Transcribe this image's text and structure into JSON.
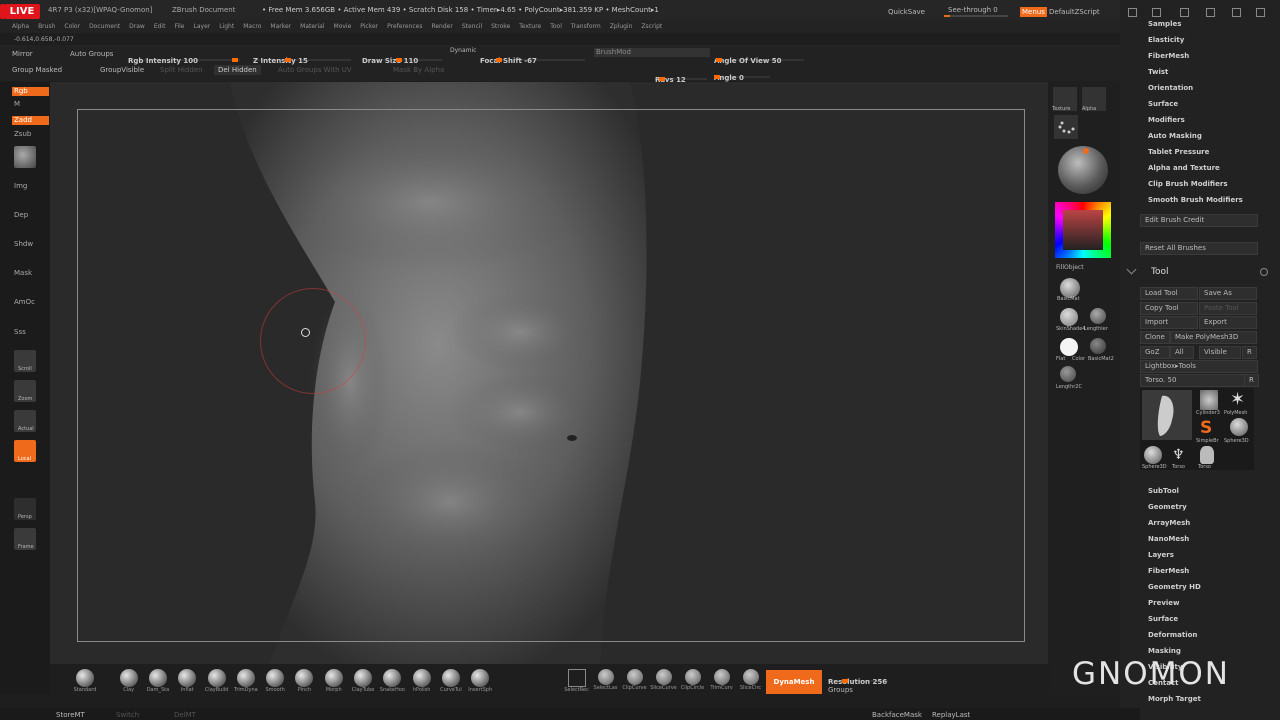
{
  "title_bar": {
    "live": "LIVE",
    "app_info": "4R7 P3 (x32)[WPAQ-Gnomon]",
    "document": "ZBrush Document",
    "mem_info": "• Free Mem 3.656GB • Active Mem 439 • Scratch Disk 158 • Timer▸4.65 • PolyCount▸381.359 KP • MeshCount▸1",
    "quicksave": "QuickSave",
    "see_through": "See-through 0",
    "menus_label": "Menus",
    "default_zscript": "DefaultZScript"
  },
  "menu": [
    "Alpha",
    "Brush",
    "Color",
    "Document",
    "Draw",
    "Edit",
    "File",
    "Layer",
    "Light",
    "Macro",
    "Marker",
    "Material",
    "Movie",
    "Picker",
    "Preferences",
    "Render",
    "Stencil",
    "Stroke",
    "Texture",
    "Tool",
    "Transform",
    "Zplugin",
    "Zscript"
  ],
  "coords": "-0.614,0.658,-0.077",
  "tool_row": {
    "mirror": "Mirror",
    "auto_groups": "Auto Groups",
    "rgb_intensity": "Rgb Intensity 100",
    "z_intensity": "Z Intensity 15",
    "draw_size": "Draw Size 110",
    "dynamic": "Dynamic",
    "focal_shift": "Focal Shift -67",
    "brush_mod": "BrushMod",
    "angle_of_view": "Angle Of View 50",
    "group_masked": "Group Masked",
    "group_visible": "GroupVisible",
    "split_hidden": "Split Hidden",
    "del_hidden": "Del Hidden",
    "auto_groups_uv": "Auto Groups With UV",
    "mask_by_alpha": "Mask By Alpha",
    "rays": "Rays 12",
    "angle": "Angle 0"
  },
  "left_shelf": [
    "Rgb",
    "M",
    "Zadd",
    "Zsub",
    "Img",
    "Dep",
    "Shdw",
    "Mask",
    "AmOc",
    "Sss",
    "Scroll",
    "Zoom",
    "Actual",
    "Local",
    "Persp",
    "Frame"
  ],
  "right_tray": {
    "texture": "Texture",
    "alpha": "Alpha",
    "fill_object": "FillObject",
    "material_labels": [
      "BasicMat",
      "SkinShade4",
      "Lengthier",
      "Flat",
      "Color",
      "BasicMat2",
      "Lengthr2C"
    ]
  },
  "right_panel": {
    "brush_items": [
      "Samples",
      "Elasticity",
      "FiberMesh",
      "Twist",
      "Orientation",
      "Surface",
      "Modifiers",
      "Auto Masking",
      "Tablet Pressure",
      "Alpha and Texture",
      "Clip Brush Modifiers",
      "Smooth Brush Modifiers"
    ],
    "edit_brush_credit": "Edit Brush Credit",
    "reset_all_brushes": "Reset All Brushes",
    "tool_header": "Tool",
    "load_tool": "Load Tool",
    "save_as": "Save As",
    "copy_tool": "Copy Tool",
    "paste_tool": "Paste Tool",
    "import": "Import",
    "export": "Export",
    "clone": "Clone",
    "make_polymesh": "Make PolyMesh3D",
    "goz": "GoZ",
    "all": "All",
    "visible": "Visible",
    "r": "R",
    "lightbox_tools": "Lightbox▸Tools",
    "torso": "Torso. 50",
    "tool_thumbs": [
      "Cylinder3",
      "PolyMesh",
      "SimpleBr",
      "Sphere3D",
      "Sphere3D",
      "Torso",
      "Torso"
    ],
    "tool_items": [
      "SubTool",
      "Geometry",
      "ArrayMesh",
      "NanoMesh",
      "Layers",
      "FiberMesh",
      "Geometry HD",
      "Preview",
      "Surface",
      "Deformation",
      "Masking",
      "Visibility",
      "Contact",
      "Morph Target"
    ]
  },
  "bottom_shelf": {
    "brushes": [
      "Standard",
      "Clay",
      "Dam_Sta",
      "Inflat",
      "ClayBuild",
      "TrimDyna",
      "Smooth",
      "Pinch",
      "Morph",
      "ClayTube",
      "SnakeHoo",
      "hPolish",
      "CurveTul",
      "InsertSph"
    ],
    "select_tools": [
      "SelectRec",
      "SelectLas",
      "ClipCurve",
      "SliceCurve",
      "ClipCircle",
      "TrimCurv",
      "SliceCirc"
    ],
    "dynamesh": "DynaMesh",
    "resolution": "Resolution 256",
    "groups": "Groups",
    "store_mt": "StoreMT",
    "switch": "Switch",
    "del_mt": "DelMT",
    "backface_mask": "BackfaceMask",
    "replay_last": "ReplayLast"
  },
  "logo": "GNOMON",
  "colors": {
    "accent": "#f06a1c",
    "live_red": "#e0141a",
    "bg": "#1e1e1e"
  }
}
